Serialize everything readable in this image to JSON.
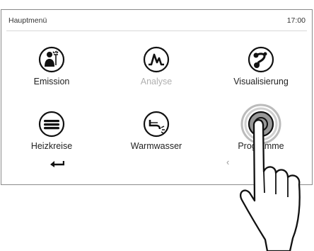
{
  "header": {
    "title": "Hauptmenü",
    "clock": "17:00"
  },
  "menu": {
    "tiles": [
      {
        "label": "Emission",
        "icon": "emission-icon",
        "enabled": true
      },
      {
        "label": "Analyse",
        "icon": "analyse-icon",
        "enabled": false
      },
      {
        "label": "Visualisierung",
        "icon": "visualisierung-icon",
        "enabled": true
      },
      {
        "label": "Heizkreise",
        "icon": "heizkreise-icon",
        "enabled": true
      },
      {
        "label": "Warmwasser",
        "icon": "warmwasser-icon",
        "enabled": true
      },
      {
        "label": "Programme",
        "icon": "programme-icon",
        "enabled": true,
        "pressed": true
      }
    ]
  },
  "footer": {
    "back_icon": "back-arrow-icon",
    "page_icon": "chevron-left-icon",
    "page_glyph": "‹"
  },
  "overlay": {
    "icon": "pointing-hand-icon"
  },
  "colors": {
    "icon_ring": "#111111",
    "disabled": "#b0b0b0",
    "press_ripple": "#999999",
    "border": "#8a8a8a"
  }
}
